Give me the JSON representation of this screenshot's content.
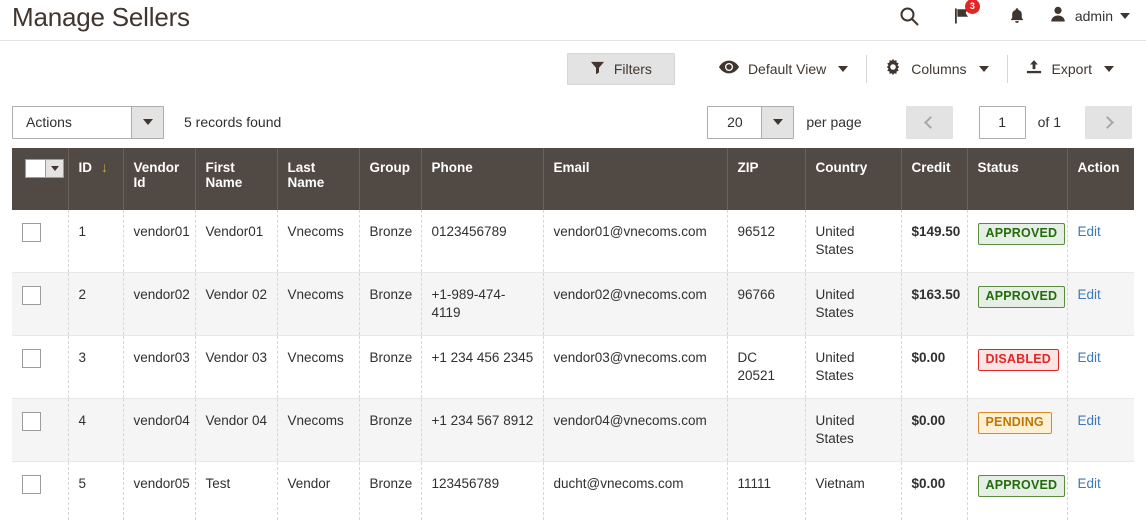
{
  "header": {
    "title": "Manage Sellers",
    "icons": [
      {
        "name": "search-icon"
      },
      {
        "name": "flag-icon",
        "badge": "3"
      },
      {
        "name": "bell-icon"
      }
    ],
    "admin": {
      "label": "admin",
      "avatar_icon": "user-avatar-icon"
    }
  },
  "toolbar": {
    "filters_label": "Filters",
    "view_label": "Default View",
    "columns_label": "Columns",
    "export_label": "Export"
  },
  "controls": {
    "actions_label": "Actions",
    "records_found": "5 records found",
    "per_page_value": "20",
    "per_page_label": "per page",
    "page_value": "1",
    "of_total": "of 1"
  },
  "grid": {
    "sort_arrow": "↓",
    "columns": [
      {
        "key": "check",
        "label": ""
      },
      {
        "key": "id",
        "label": "ID"
      },
      {
        "key": "vendor",
        "label": "Vendor Id"
      },
      {
        "key": "first",
        "label": "First Name"
      },
      {
        "key": "last",
        "label": "Last Name"
      },
      {
        "key": "group",
        "label": "Group"
      },
      {
        "key": "phone",
        "label": "Phone"
      },
      {
        "key": "email",
        "label": "Email"
      },
      {
        "key": "zip",
        "label": "ZIP"
      },
      {
        "key": "country",
        "label": "Country"
      },
      {
        "key": "credit",
        "label": "Credit"
      },
      {
        "key": "status",
        "label": "Status"
      },
      {
        "key": "action",
        "label": "Action"
      }
    ],
    "rows": [
      {
        "id": "1",
        "vendor": "vendor01",
        "first": "Vendor01",
        "last": "Vnecoms",
        "group": "Bronze",
        "phone": "0123456789",
        "email": "vendor01@vnecoms.com",
        "zip": "96512",
        "country": "United States",
        "credit": "$149.50",
        "status": "APPROVED",
        "status_kind": "approved",
        "action": "Edit"
      },
      {
        "id": "2",
        "vendor": "vendor02",
        "first": "Vendor 02",
        "last": "Vnecoms",
        "group": "Bronze",
        "phone": "+1-989-474-4119",
        "email": "vendor02@vnecoms.com",
        "zip": "96766",
        "country": "United States",
        "credit": "$163.50",
        "status": "APPROVED",
        "status_kind": "approved",
        "action": "Edit"
      },
      {
        "id": "3",
        "vendor": "vendor03",
        "first": "Vendor 03",
        "last": "Vnecoms",
        "group": "Bronze",
        "phone": "+1 234 456 2345",
        "email": "vendor03@vnecoms.com",
        "zip": "DC 20521",
        "country": "United States",
        "credit": "$0.00",
        "status": "DISABLED",
        "status_kind": "disabled",
        "action": "Edit"
      },
      {
        "id": "4",
        "vendor": "vendor04",
        "first": "Vendor 04",
        "last": "Vnecoms",
        "group": "Bronze",
        "phone": "+1 234 567 8912",
        "email": "vendor04@vnecoms.com",
        "zip": "",
        "country": "United States",
        "credit": "$0.00",
        "status": "PENDING",
        "status_kind": "pending",
        "action": "Edit"
      },
      {
        "id": "5",
        "vendor": "vendor05",
        "first": "Test",
        "last": "Vendor",
        "group": "Bronze",
        "phone": "123456789",
        "email": "ducht@vnecoms.com",
        "zip": "11111",
        "country": "Vietnam",
        "credit": "$0.00",
        "status": "APPROVED",
        "status_kind": "approved",
        "action": "Edit"
      }
    ]
  },
  "colors": {
    "header_bg": "#514943",
    "accent_orange": "#d9892a",
    "link_blue": "#3d7ab5",
    "badge_red": "#e22626"
  }
}
